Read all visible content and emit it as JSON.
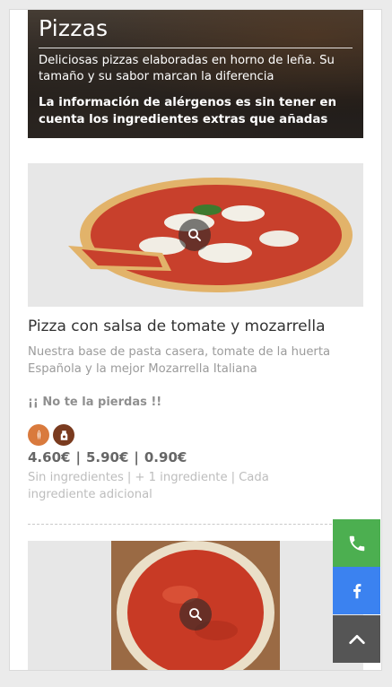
{
  "header": {
    "title": "Pizzas",
    "description": "Deliciosas pizzas elaboradas en horno de leña. Su tamaño y su sabor marcan la diferencia",
    "allergen_notice": "La información de alérgenos es sin tener en cuenta los ingredientes extras que añadas"
  },
  "products": [
    {
      "name": "Pizza con salsa de tomate y mozarrella",
      "description": "Nuestra base de pasta casera, tomate de la huerta Española y la mejor Mozarrella Italiana",
      "promo": "¡¡ No te la pierdas !!",
      "allergens": [
        "gluten-icon",
        "dairy-icon"
      ],
      "prices": [
        "4.60€",
        "5.90€",
        "0.90€"
      ],
      "price_notes": [
        "Sin ingredientes",
        "+ 1 ingrediente",
        "Cada ingrediente adicional"
      ],
      "price_separator": "|"
    }
  ],
  "fab": {
    "phone_icon": "phone-icon",
    "facebook_icon": "facebook-icon",
    "top_icon": "chevron-up-icon"
  },
  "colors": {
    "phone": "#4caf50",
    "facebook": "#3b82f0",
    "scroll_top": "#555555",
    "gluten_badge": "#d97a3d",
    "dairy_badge": "#7a3b1f"
  }
}
